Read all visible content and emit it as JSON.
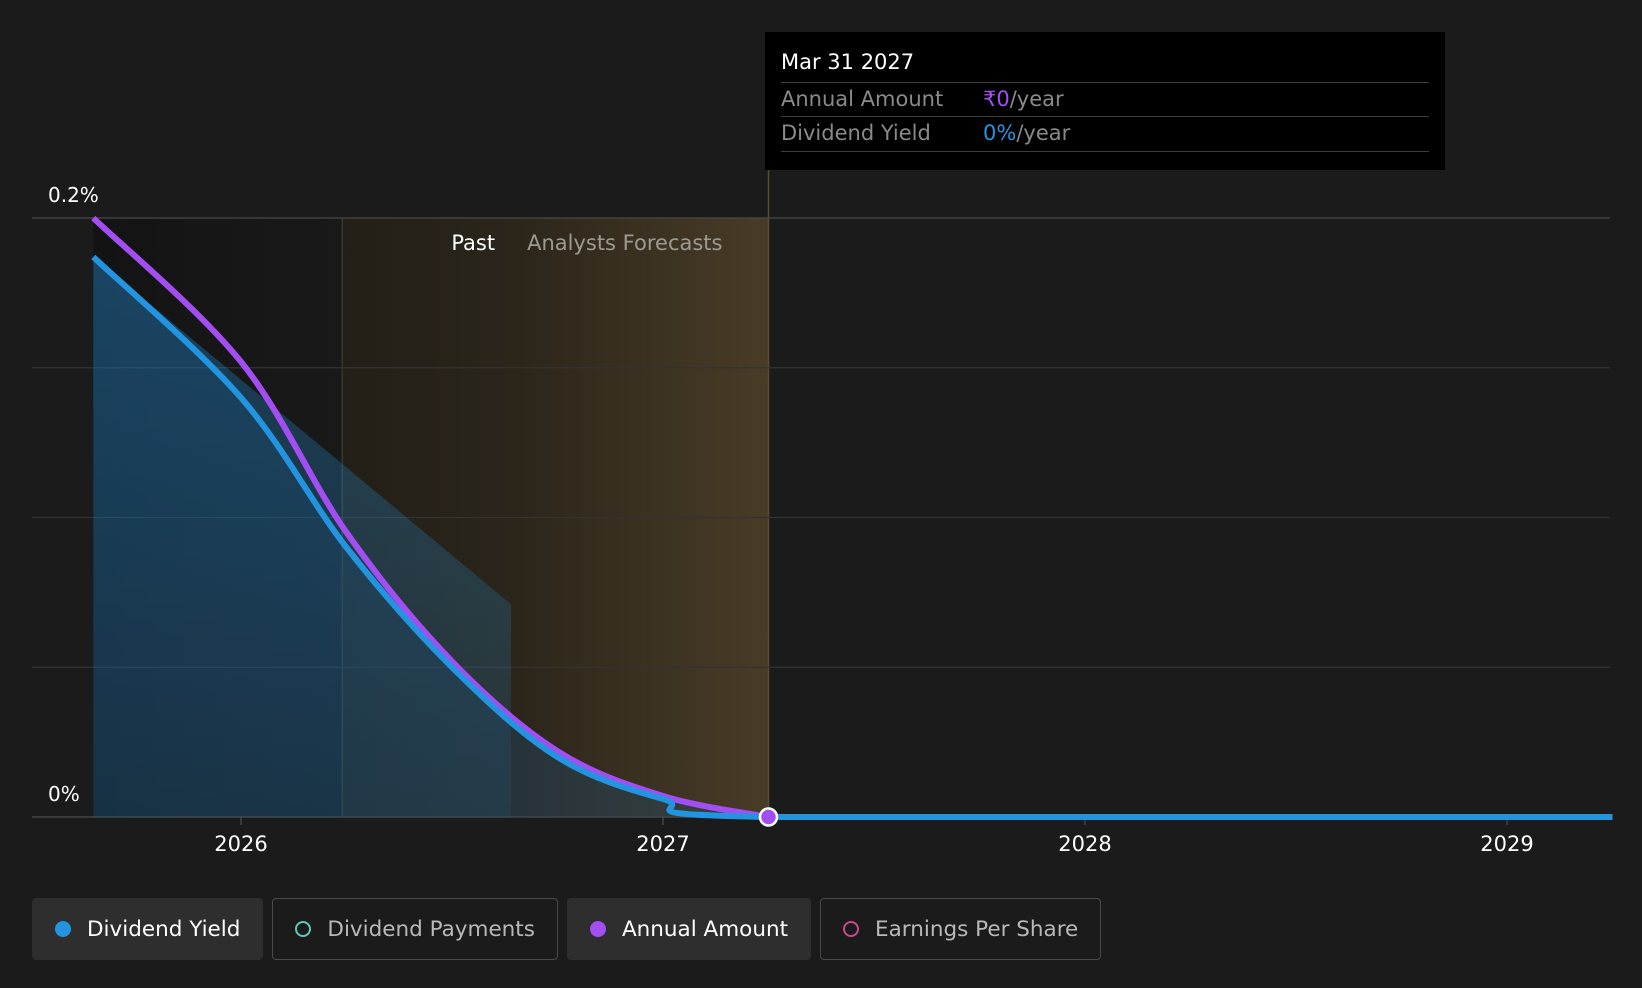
{
  "chart_data": {
    "type": "line",
    "x_axis": {
      "ticks": [
        "2026",
        "2027",
        "2028",
        "2029"
      ]
    },
    "y_axis": {
      "tick_labels": [
        "0%",
        "0.2%"
      ],
      "ylim": [
        0,
        0.2
      ],
      "unit": "%"
    },
    "regions": {
      "past_label": "Past",
      "forecast_label": "Analysts Forecasts"
    },
    "series": [
      {
        "name": "Dividend Yield",
        "color": "#2394df",
        "points": [
          {
            "x": 2025.65,
            "y": 0.187
          },
          {
            "x": 2026.0,
            "y": 0.14
          },
          {
            "x": 2026.25,
            "y": 0.09
          },
          {
            "x": 2026.5,
            "y": 0.05
          },
          {
            "x": 2026.75,
            "y": 0.02
          },
          {
            "x": 2027.0,
            "y": 0.006
          },
          {
            "x": 2027.25,
            "y": 0.0
          },
          {
            "x": 2029.25,
            "y": 0.0
          }
        ]
      },
      {
        "name": "Annual Amount",
        "color": "#a34ef2",
        "points": [
          {
            "x": 2025.65,
            "y": 0.2
          },
          {
            "x": 2026.0,
            "y": 0.152
          },
          {
            "x": 2026.25,
            "y": 0.095
          },
          {
            "x": 2026.5,
            "y": 0.052
          },
          {
            "x": 2026.75,
            "y": 0.022
          },
          {
            "x": 2027.0,
            "y": 0.007
          },
          {
            "x": 2027.25,
            "y": 0.0
          }
        ]
      }
    ],
    "grid": true
  },
  "tooltip": {
    "date": "Mar 31 2027",
    "rows": [
      {
        "label": "Annual Amount",
        "value": "₹0",
        "unit": "/year",
        "color": "#a34ef2"
      },
      {
        "label": "Dividend Yield",
        "value": "0%",
        "unit": "/year",
        "color": "#2394df"
      }
    ]
  },
  "legend": [
    {
      "label": "Dividend Yield",
      "color": "#2394df",
      "active": true,
      "filled": true
    },
    {
      "label": "Dividend Payments",
      "color": "#5fc9b8",
      "active": false,
      "filled": false
    },
    {
      "label": "Annual Amount",
      "color": "#a34ef2",
      "active": true,
      "filled": true
    },
    {
      "label": "Earnings Per Share",
      "color": "#c94a8a",
      "active": false,
      "filled": false
    }
  ]
}
